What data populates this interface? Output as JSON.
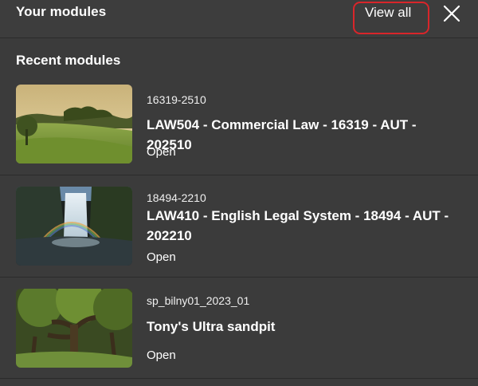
{
  "header": {
    "title": "Your modules",
    "view_all": "View all",
    "close_icon": "close-icon",
    "highlight_color": "#d9252a"
  },
  "section": {
    "title": "Recent modules"
  },
  "modules": [
    {
      "code": "16319-2510",
      "title": "LAW504 - Commercial Law - 16319 - AUT - 202510",
      "action": "Open",
      "thumbnail": "meadow-landscape-image"
    },
    {
      "code": "18494-2210",
      "title": "LAW410 - English Legal System - 18494 - AUT - 202210",
      "action": "Open",
      "thumbnail": "waterfall-image"
    },
    {
      "code": "sp_bilny01_2023_01",
      "title": "Tony's Ultra sandpit",
      "action": "Open",
      "thumbnail": "forest-image"
    }
  ],
  "colors": {
    "background": "#3b3b3b",
    "divider": "#2b2b2b",
    "text": "#ffffff"
  }
}
